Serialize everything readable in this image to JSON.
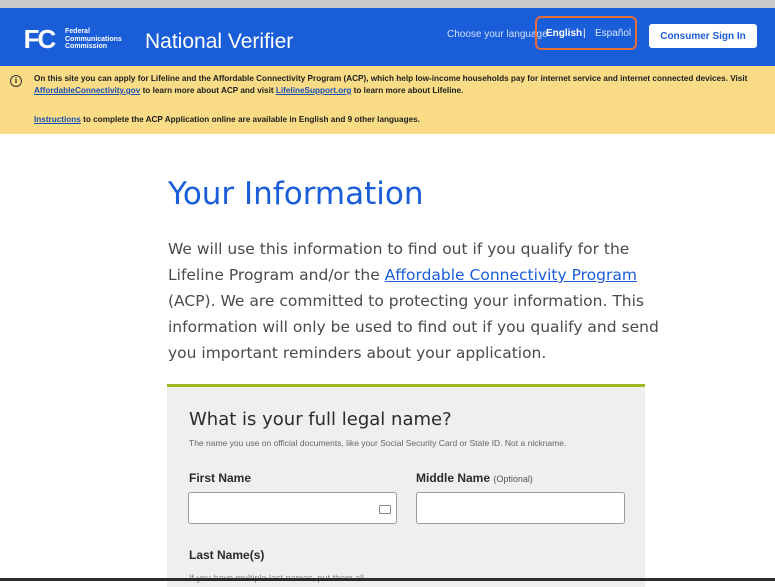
{
  "header": {
    "logo_text": "FC",
    "agency_lines": [
      "Federal",
      "Communications",
      "Commission"
    ],
    "site_title": "National Verifier",
    "language_prompt": "Choose your language",
    "lang_english": "English",
    "lang_separator": "|",
    "lang_spanish": "Español",
    "sign_in_label": "Consumer Sign In"
  },
  "alert": {
    "part1": "On this site you can apply for Lifeline and the Affordable Connectivity Program (ACP), which help low-income households pay for internet service and internet connected devices. Visit ",
    "link1": "AffordableConnectivity.gov",
    "part2": " to learn more about ACP and visit ",
    "link2": "LifelineSupport.org",
    "part3": " to learn more about Lifeline.",
    "instructions_link": "Instructions",
    "instructions_text": " to complete the ACP Application online are available in English and 9 other languages."
  },
  "main": {
    "title": "Your Information",
    "intro_part1": "We will use this information to find out if you qualify for the Lifeline Program and/or the ",
    "intro_link": "Affordable Connectivity Program",
    "intro_part2": " (ACP). We are committed to protecting your information. This information will only be used to find out if you qualify and send you important reminders about your application."
  },
  "form": {
    "question": "What is your full legal name?",
    "question_help": "The name you use on official documents, like your Social Security Card or State ID. Not a nickname.",
    "first_name_label": "First Name",
    "first_name_value": "",
    "middle_name_label": "Middle Name",
    "middle_name_optional": "(Optional)",
    "middle_name_value": "",
    "last_name_label": "Last Name(s)",
    "last_name_help": "If you have multiple last names, put them all."
  },
  "colors": {
    "header_bg": "#1a5dd8",
    "alert_bg": "#f9dc85",
    "title_blue": "#1a5dd8",
    "card_accent": "#a3b822",
    "highlight_box": "#e86b3a"
  }
}
